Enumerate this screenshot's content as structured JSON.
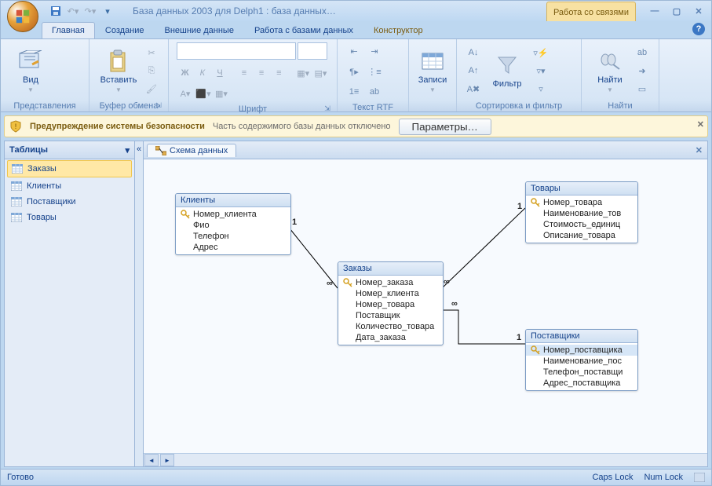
{
  "title": "База данных 2003 для Delph1 : база данных…",
  "context_tab_group": "Работа со связями",
  "tabs": [
    "Главная",
    "Создание",
    "Внешние данные",
    "Работа с базами данных",
    "Конструктор"
  ],
  "ribbon": {
    "view": "Вид",
    "paste": "Вставить",
    "records": "Записи",
    "filter": "Фильтр",
    "find": "Найти",
    "grp_views": "Представления",
    "grp_clip": "Буфер обмена",
    "grp_font": "Шрифт",
    "grp_rtf": "Текст RTF",
    "grp_sort": "Сортировка и фильтр",
    "grp_find": "Найти"
  },
  "security": {
    "title": "Предупреждение системы безопасности",
    "msg": "Часть содержимого базы данных отключено",
    "btn": "Параметры…"
  },
  "nav": {
    "header": "Таблицы",
    "items": [
      "Заказы",
      "Клиенты",
      "Поставщики",
      "Товары"
    ]
  },
  "doc_tab": "Схема данных",
  "entities": {
    "clients": {
      "title": "Клиенты",
      "fields": [
        {
          "n": "Номер_клиента",
          "k": true
        },
        {
          "n": "Фио"
        },
        {
          "n": "Телефон"
        },
        {
          "n": "Адрес"
        }
      ]
    },
    "orders": {
      "title": "Заказы",
      "fields": [
        {
          "n": "Номер_заказа",
          "k": true
        },
        {
          "n": "Номер_клиента"
        },
        {
          "n": "Номер_товара"
        },
        {
          "n": "Поставщик"
        },
        {
          "n": "Количество_товара"
        },
        {
          "n": "Дата_заказа"
        }
      ]
    },
    "goods": {
      "title": "Товары",
      "fields": [
        {
          "n": "Номер_товара",
          "k": true
        },
        {
          "n": "Наименование_тов"
        },
        {
          "n": "Стоимость_единиц"
        },
        {
          "n": "Описание_товара"
        }
      ]
    },
    "suppliers": {
      "title": "Поставщики",
      "fields": [
        {
          "n": "Номер_поставщика",
          "k": true,
          "sel": true
        },
        {
          "n": "Наименование_пос"
        },
        {
          "n": "Телефон_поставщи"
        },
        {
          "n": "Адрес_поставщика"
        }
      ]
    }
  },
  "status": {
    "ready": "Готово",
    "caps": "Caps Lock",
    "num": "Num Lock"
  }
}
